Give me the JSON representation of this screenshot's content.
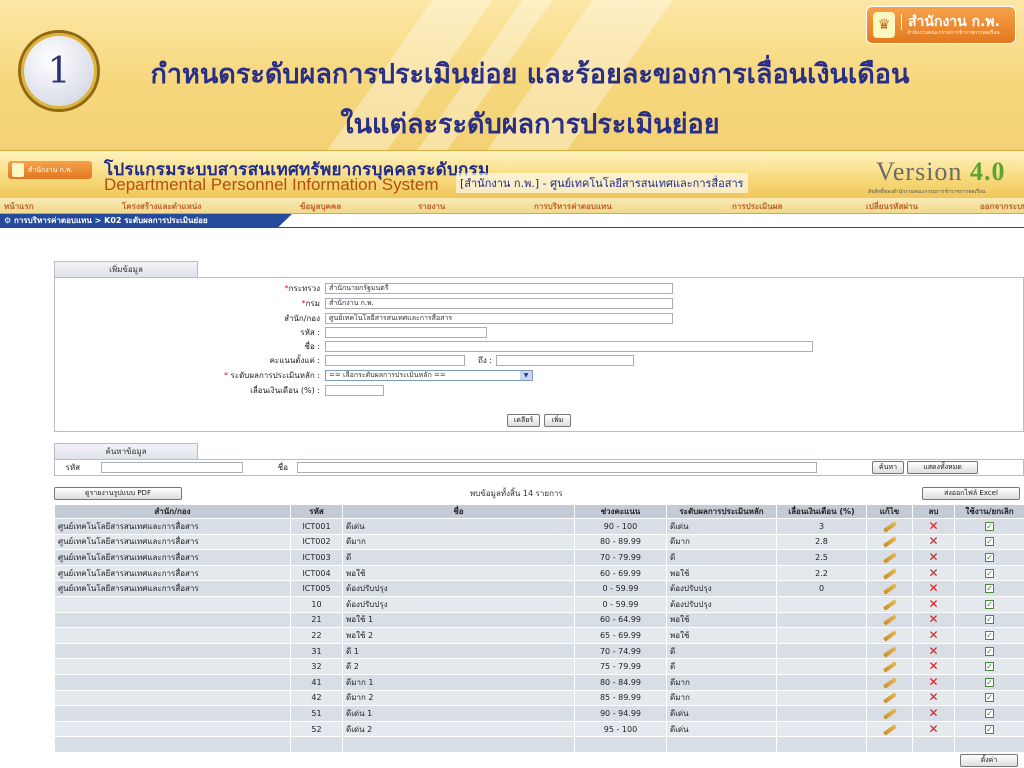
{
  "slide": {
    "step_number": "1",
    "title_line1": "กำหนดระดับผลการประเมินย่อย และร้อยละของการเลื่อนเงินเดือน",
    "title_line2": "ในแต่ละระดับผลการประเมินย่อย",
    "badge_name": "สำนักงาน ก.พ.",
    "badge_sub": "สำนักงานคณะกรรมการข้าราชการพลเรือน"
  },
  "banner": {
    "logo_small": "สำนักงาน ก.พ.",
    "system_th": "โปรแกรมระบบสารสนเทศทรัพยากรบุคคลระดับกรม",
    "system_en": "Departmental Personnel Information System",
    "department": "[สำนักงาน ก.พ.] - ศูนย์เทคโนโลยีสารสนเทศและการสื่อสาร",
    "version_word": "Version",
    "version_num": "4.0",
    "version_sub": "ลิขสิทธิ์ของสำนักงานคณะกรรมการข้าราชการพลเรือน"
  },
  "menu": {
    "items": [
      "หน้าแรก",
      "โครงสร้างและตำแหน่ง",
      "ข้อมูลบุคคล",
      "รายงาน",
      "การบริหารค่าตอบแทน",
      "การประเมินผล",
      "เปลี่ยนรหัสผ่าน",
      "ออกจากระบบ"
    ]
  },
  "breadcrumb": "การบริหารค่าตอบแทน > K02 ระดับผลการประเมินย่อย",
  "add_form": {
    "tab": "เพิ่มข้อมูล",
    "ministry_label": "กระทรวง",
    "ministry_value": "สำนักนายกรัฐมนตรี",
    "dept_label": "กรม",
    "dept_value": "สำนักงาน ก.พ.",
    "office_label": "สำนัก/กอง",
    "office_value": "ศูนย์เทคโนโลยีสารสนเทศและการสื่อสาร",
    "code_label": "รหัส :",
    "name_label": "ชื่อ :",
    "score_from_label": "คะแนนตั้งแต่ :",
    "score_to_label": "ถึง :",
    "main_level_label": "ระดับผลการประเมินหลัก :",
    "main_level_value": "== เลือกระดับผลการประเมินหลัก ==",
    "raise_label": "เลื่อนเงินเดือน (%) :",
    "clear_button": "เคลียร์",
    "add_button": "เพิ่ม"
  },
  "search_form": {
    "tab": "ค้นหาข้อมูล",
    "code_label": "รหัส",
    "name_label": "ชื่อ",
    "search_button": "ค้นหา",
    "show_all_button": "แสดงทั้งหมด"
  },
  "results": {
    "pdf_button": "ดูรายงานรูปแบบ PDF",
    "summary": "พบข้อมูลทั้งสิ้น 14 รายการ",
    "excel_button": "ส่งออกไฟล์ Excel",
    "columns": [
      "สำนัก/กอง",
      "รหัส",
      "ชื่อ",
      "ช่วงคะแนน",
      "ระดับผลการประเมินหลัก",
      "เลื่อนเงินเดือน (%)",
      "แก้ไข",
      "ลบ",
      "ใช้งาน/ยกเลิก"
    ],
    "rows": [
      [
        "ศูนย์เทคโนโลยีสารสนเทศและการสื่อสาร",
        "ICT001",
        "ดีเด่น",
        "90 - 100",
        "ดีเด่น",
        "3"
      ],
      [
        "ศูนย์เทคโนโลยีสารสนเทศและการสื่อสาร",
        "ICT002",
        "ดีมาก",
        "80 - 89.99",
        "ดีมาก",
        "2.8"
      ],
      [
        "ศูนย์เทคโนโลยีสารสนเทศและการสื่อสาร",
        "ICT003",
        "ดี",
        "70 - 79.99",
        "ดี",
        "2.5"
      ],
      [
        "ศูนย์เทคโนโลยีสารสนเทศและการสื่อสาร",
        "ICT004",
        "พอใช้",
        "60 - 69.99",
        "พอใช้",
        "2.2"
      ],
      [
        "ศูนย์เทคโนโลยีสารสนเทศและการสื่อสาร",
        "ICT005",
        "ต้องปรับปรุง",
        "0 - 59.99",
        "ต้องปรับปรุง",
        "0"
      ],
      [
        "",
        "10",
        "ต้องปรับปรุง",
        "0 - 59.99",
        "ต้องปรับปรุง",
        ""
      ],
      [
        "",
        "21",
        "พอใช้ 1",
        "60 - 64.99",
        "พอใช้",
        ""
      ],
      [
        "",
        "22",
        "พอใช้ 2",
        "65 - 69.99",
        "พอใช้",
        ""
      ],
      [
        "",
        "31",
        "ดี 1",
        "70 - 74.99",
        "ดี",
        ""
      ],
      [
        "",
        "32",
        "ดี 2",
        "75 - 79.99",
        "ดี",
        ""
      ],
      [
        "",
        "41",
        "ดีมาก 1",
        "80 - 84.99",
        "ดีมาก",
        ""
      ],
      [
        "",
        "42",
        "ดีมาก 2",
        "85 - 89.99",
        "ดีมาก",
        ""
      ],
      [
        "",
        "51",
        "ดีเด่น 1",
        "90 - 94.99",
        "ดีเด่น",
        ""
      ],
      [
        "",
        "52",
        "ดีเด่น 2",
        "95 - 100",
        "ดีเด่น",
        ""
      ]
    ],
    "save_button": "ตั้งค่า"
  }
}
